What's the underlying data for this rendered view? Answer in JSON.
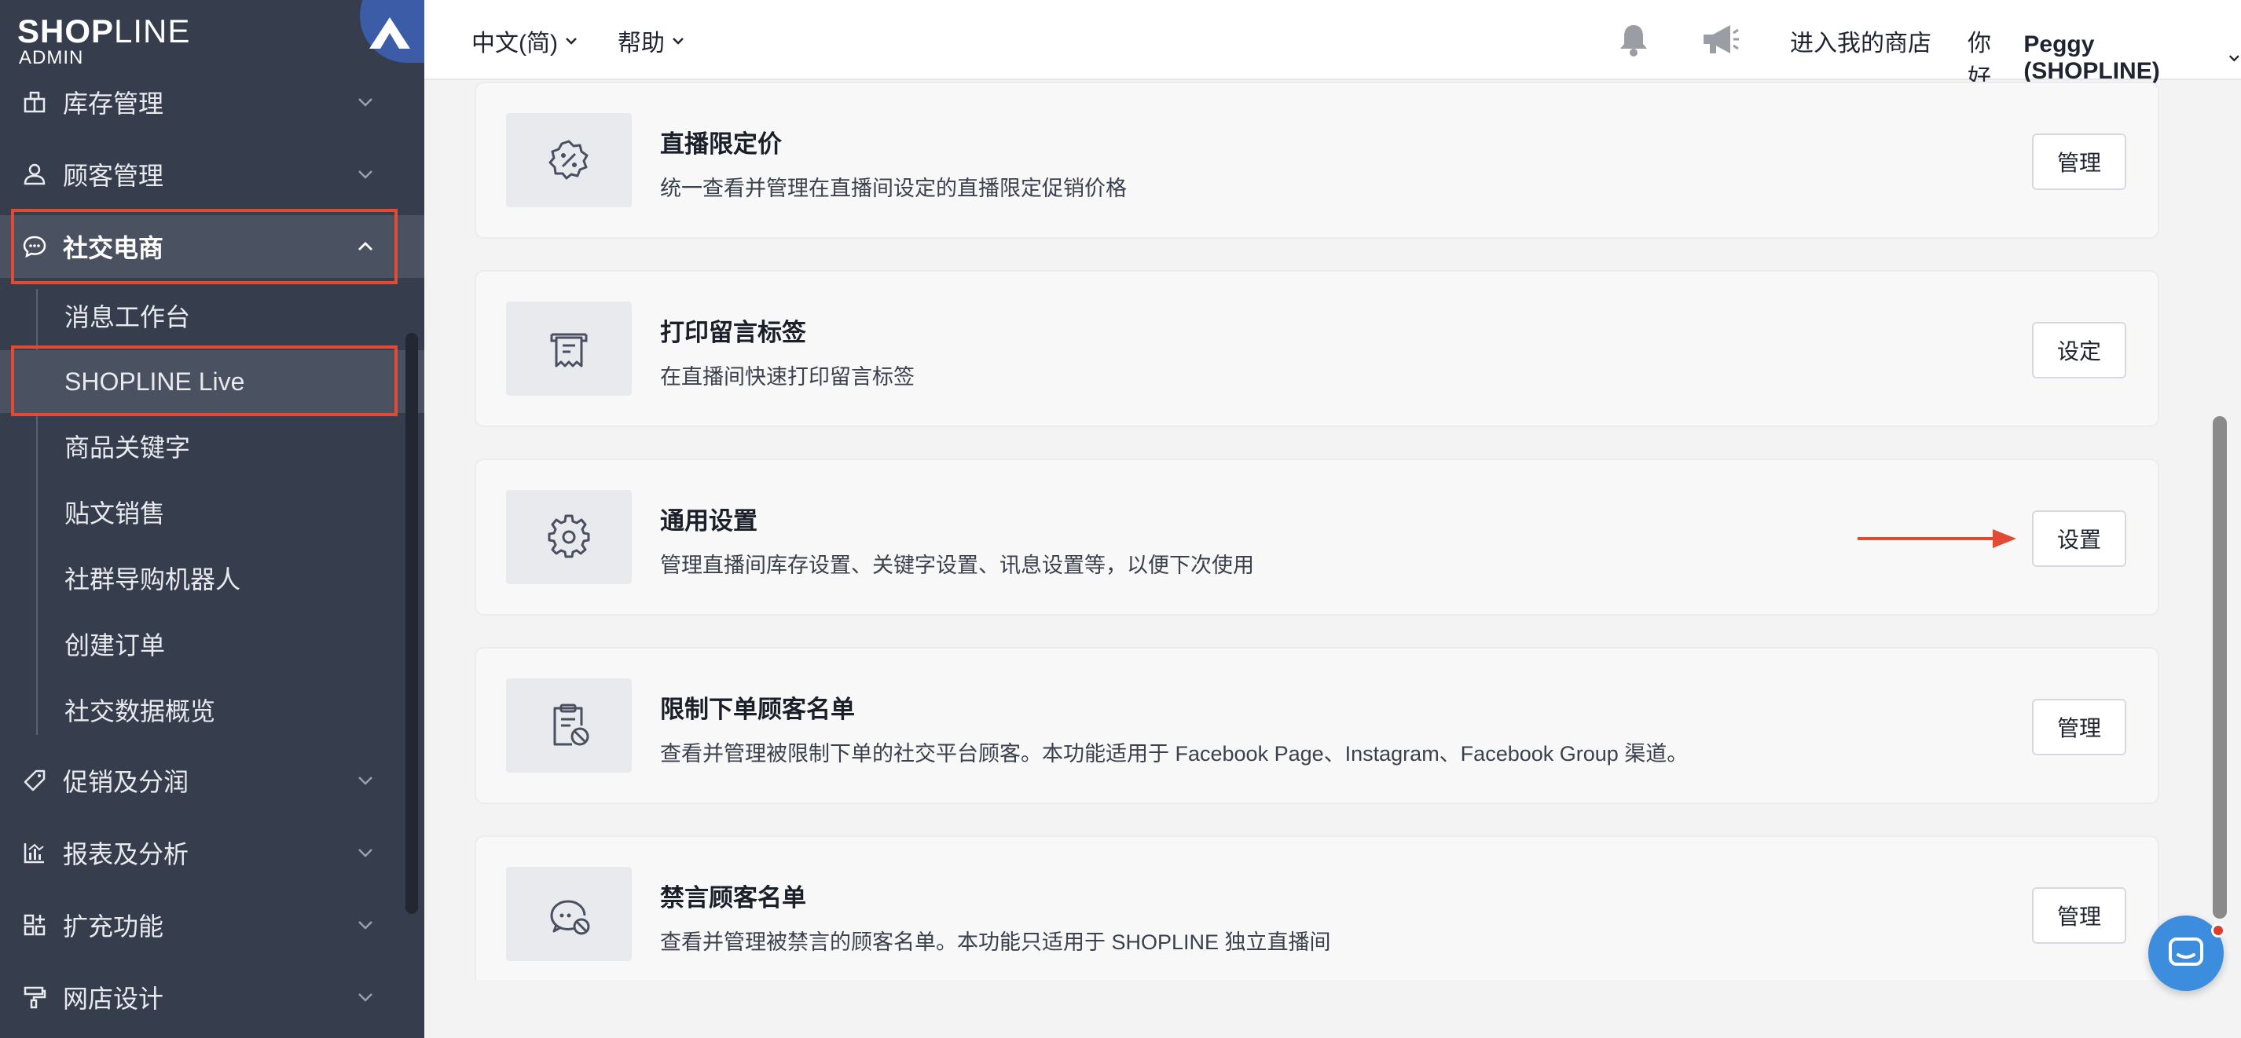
{
  "logo": {
    "brand_main": "SHOP",
    "brand_tail": "LINE",
    "sub": "ADMIN"
  },
  "sidebar": {
    "items": [
      {
        "label": "库存管理",
        "icon": "inventory-icon"
      },
      {
        "label": "顾客管理",
        "icon": "user-icon"
      },
      {
        "label": "社交电商",
        "icon": "chat-bubble-icon"
      },
      {
        "label": "促销及分润",
        "icon": "tag-icon"
      },
      {
        "label": "报表及分析",
        "icon": "chart-icon"
      },
      {
        "label": "扩充功能",
        "icon": "apps-icon"
      },
      {
        "label": "网店设计",
        "icon": "paint-roller-icon"
      }
    ],
    "sub_items": [
      {
        "label": "消息工作台"
      },
      {
        "label": "SHOPLINE Live"
      },
      {
        "label": "商品关键字"
      },
      {
        "label": "贴文销售"
      },
      {
        "label": "社群导购机器人"
      },
      {
        "label": "创建订单"
      },
      {
        "label": "社交数据概览"
      }
    ]
  },
  "header": {
    "language": "中文(简)",
    "help": "帮助",
    "store_link": "进入我的商店",
    "greeting_prefix": "你好,",
    "user": "Peggy (SHOPLINE)"
  },
  "cards": [
    {
      "title": "直播限定价",
      "desc": "统一查看并管理在直播间设定的直播限定促销价格",
      "button": "管理",
      "icon": "percent-badge-icon"
    },
    {
      "title": "打印留言标签",
      "desc": "在直播间快速打印留言标签",
      "button": "设定",
      "icon": "print-label-icon"
    },
    {
      "title": "通用设置",
      "desc": "管理直播间库存设置、关键字设置、讯息设置等，以便下次使用",
      "button": "设置",
      "icon": "gear-icon"
    },
    {
      "title": "限制下单顾客名单",
      "desc": "查看并管理被限制下单的社交平台顾客。本功能适用于 Facebook Page、Instagram、Facebook Group 渠道。",
      "button": "管理",
      "icon": "blocked-list-icon"
    },
    {
      "title": "禁言顾客名单",
      "desc": "查看并管理被禁言的顾客名单。本功能只适用于 SHOPLINE 独立直播间",
      "button": "管理",
      "icon": "mute-chat-icon"
    }
  ],
  "colors": {
    "sidebar_bg": "#363d4d",
    "highlight": "#e34a33",
    "accent": "#3c8dde"
  }
}
